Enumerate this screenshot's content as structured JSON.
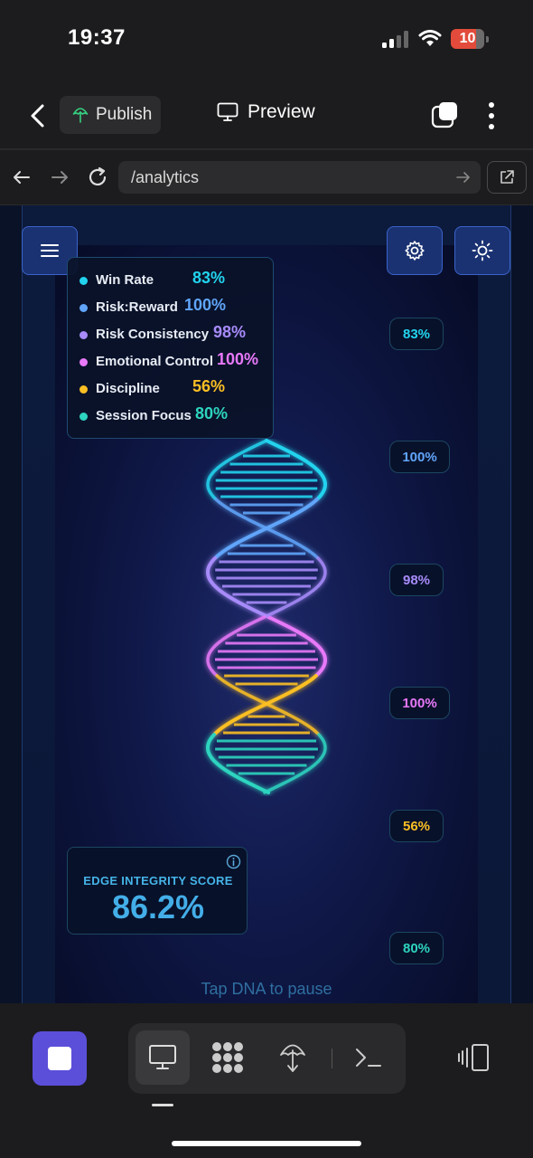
{
  "status_bar": {
    "time": "19:37",
    "battery": "10"
  },
  "topbar": {
    "publish_label": "Publish",
    "preview_label": "Preview"
  },
  "browser": {
    "url": "/analytics"
  },
  "legend": {
    "items": [
      {
        "label": "Win Rate",
        "value": "83%",
        "color": "#22d3ee"
      },
      {
        "label": "Risk:Reward",
        "value": "100%",
        "color": "#60a5fa"
      },
      {
        "label": "Risk Consistency",
        "value": "98%",
        "color": "#a78bfa"
      },
      {
        "label": "Emotional Control",
        "value": "100%",
        "color": "#e879f9"
      },
      {
        "label": "Discipline",
        "value": "56%",
        "color": "#fbbf24"
      },
      {
        "label": "Session Focus",
        "value": "80%",
        "color": "#2dd4bf"
      }
    ]
  },
  "badges": [
    "83%",
    "100%",
    "98%",
    "100%",
    "56%",
    "80%"
  ],
  "score": {
    "title": "EDGE INTEGRITY SCORE",
    "value": "86.2%"
  },
  "hint": "Tap DNA to pause",
  "icons": {
    "menu": "menu-icon",
    "settings": "gear-icon",
    "theme": "sun-icon",
    "desktop": "monitor-icon",
    "grid": "blob-grid-icon",
    "publish": "umbrella-icon",
    "terminal": "terminal-icon",
    "device": "device-toggle-icon"
  }
}
